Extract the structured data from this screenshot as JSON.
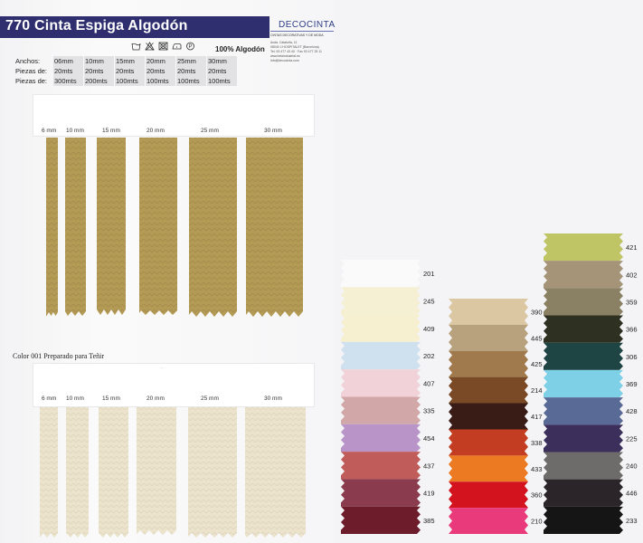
{
  "title": "770 Cinta Espiga Algodón",
  "brand": {
    "name": "DECOCINTA",
    "tagline": "CINTAS DECORATIVAS Y DE MODA",
    "address_lines": [
      "Avda. Cataluña, 11",
      "08040 L'HOSPITALET (Barcelona)",
      "Tel. 93 477 43 40 · Fax 93 477 25 11",
      "www.telaindustrial.es",
      "info@decocinta.com"
    ]
  },
  "care_icons": [
    "wash-30-icon",
    "no-bleach-icon",
    "no-tumble-dry-icon",
    "iron-icon",
    "dry-clean-p-icon"
  ],
  "material": "100% Algodón",
  "specs": [
    {
      "label": "Anchos:",
      "values": [
        "06mm",
        "10mm",
        "15mm",
        "20mm",
        "25mm",
        "30mm"
      ]
    },
    {
      "label": "Piezas de:",
      "values": [
        "20mts",
        "20mts",
        "20mts",
        "20mts",
        "20mts",
        "20mts"
      ]
    },
    {
      "label": "Piezas de:",
      "values": [
        "300mts",
        "200mts",
        "100mts",
        "100mts",
        "100mts",
        "100mts"
      ]
    }
  ],
  "widths": [
    "6 mm",
    "10 mm",
    "15 mm",
    "20 mm",
    "25 mm",
    "30 mm"
  ],
  "caption": "Color 001 Preparado para Teñir",
  "card_mark": "·",
  "colors": {
    "tan": "#b39a55",
    "natural": "#ebe3cc",
    "title_bg": "#2f2f6f"
  },
  "swatch_columns": [
    {
      "swatches": [
        {
          "code": "201",
          "color": "#fafafa"
        },
        {
          "code": "245",
          "color": "#f5f0d3"
        },
        {
          "code": "409",
          "color": "#f6efd0"
        },
        {
          "code": "202",
          "color": "#cfe1ee"
        },
        {
          "code": "407",
          "color": "#f1d2d8"
        },
        {
          "code": "335",
          "color": "#d2a7a7"
        },
        {
          "code": "454",
          "color": "#b994c9"
        },
        {
          "code": "437",
          "color": "#c05c5a"
        },
        {
          "code": "419",
          "color": "#8a3c4e"
        },
        {
          "code": "385",
          "color": "#6d1c2c"
        }
      ]
    },
    {
      "swatches": [
        {
          "code": "390",
          "color": "#dcc7a3"
        },
        {
          "code": "445",
          "color": "#b8a27e"
        },
        {
          "code": "425",
          "color": "#a07a4c"
        },
        {
          "code": "214",
          "color": "#7a4a26"
        },
        {
          "code": "417",
          "color": "#3a1c16"
        },
        {
          "code": "338",
          "color": "#c23d21"
        },
        {
          "code": "433",
          "color": "#ec7a23"
        },
        {
          "code": "360",
          "color": "#d3141e"
        },
        {
          "code": "210",
          "color": "#e93a7c"
        }
      ]
    },
    {
      "swatches": [
        {
          "code": "421",
          "color": "#bfc465"
        },
        {
          "code": "402",
          "color": "#a59478"
        },
        {
          "code": "359",
          "color": "#8a8063"
        },
        {
          "code": "366",
          "color": "#2e3021"
        },
        {
          "code": "306",
          "color": "#1e4543"
        },
        {
          "code": "369",
          "color": "#7ed0e6"
        },
        {
          "code": "428",
          "color": "#5a6a96"
        },
        {
          "code": "225",
          "color": "#3c2f5c"
        },
        {
          "code": "240",
          "color": "#6e6c6b"
        },
        {
          "code": "446",
          "color": "#2b2529"
        },
        {
          "code": "233",
          "color": "#151516"
        }
      ]
    }
  ]
}
